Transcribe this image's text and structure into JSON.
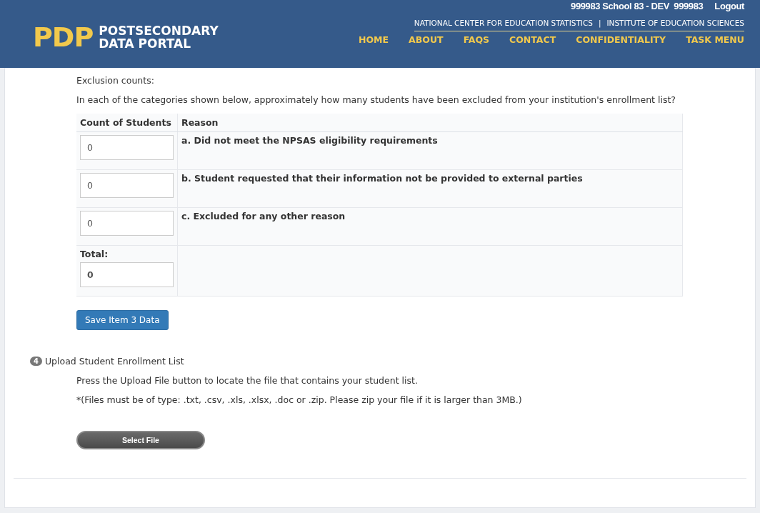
{
  "header": {
    "user": "999983 School 83 - DEV  999983",
    "logout": "Logout",
    "logo_mark": "PDP",
    "logo_line_1": "POSTSECONDARY",
    "logo_line_2": "DATA PORTAL",
    "agency_links": [
      "NATIONAL CENTER FOR EDUCATION STATISTICS",
      "INSTITUTE OF EDUCATION SCIENCES"
    ],
    "separator": "|",
    "nav": [
      "HOME",
      "ABOUT",
      "FAQS",
      "CONTACT",
      "CONFIDENTIALITY",
      "TASK MENU"
    ]
  },
  "exclusions": {
    "title": "Exclusion counts:",
    "question": "In each of the categories shown below, approximately how many students have been excluded from your institution's enrollment list?",
    "columns": [
      "Count of Students",
      "Reason"
    ],
    "rows": [
      {
        "value": "0",
        "reason": "a. Did not meet the NPSAS eligibility requirements"
      },
      {
        "value": "0",
        "reason": "b. Student requested that their information not be provided to external parties"
      },
      {
        "value": "0",
        "reason": "c. Excluded for any other reason"
      }
    ],
    "total_label": "Total:",
    "total_value": "0",
    "save_button": "Save Item 3 Data"
  },
  "upload": {
    "step": "4",
    "title": "Upload Student Enrollment List",
    "instruction": "Press the Upload File button to locate the file that contains your student list.",
    "note": "*(Files must be of type: .txt, .csv, .xls, .xlsx, .doc or .zip. Please zip your file if it is larger than 3MB.)",
    "button": "Select File"
  }
}
